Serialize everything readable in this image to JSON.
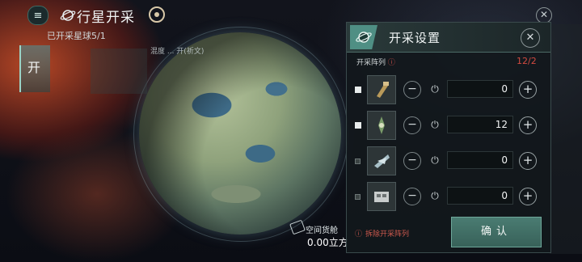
{
  "header": {
    "title": "行星开采",
    "subtitle": "已开采星球5/1",
    "menu_icon": "≡"
  },
  "left_tab": {
    "label": "开"
  },
  "planet": {
    "name": "混度 ... 开(祈文)"
  },
  "cargo": {
    "label": "空间货舱",
    "value": "0.00立方"
  },
  "panel": {
    "title": "开采设置",
    "array_label": "开采阵列",
    "array_count": "12/2",
    "rows": [
      {
        "enabled": true,
        "value": "0",
        "icon": "drill-icon"
      },
      {
        "enabled": true,
        "value": "12",
        "icon": "extractor-icon"
      },
      {
        "enabled": false,
        "value": "0",
        "icon": "scanner-icon"
      },
      {
        "enabled": false,
        "value": "0",
        "icon": "container-icon"
      }
    ],
    "dismantle_label": "拆除开采阵列",
    "confirm_label": "确认"
  },
  "colors": {
    "accent": "#4a7c72",
    "warning": "#d24a40"
  }
}
